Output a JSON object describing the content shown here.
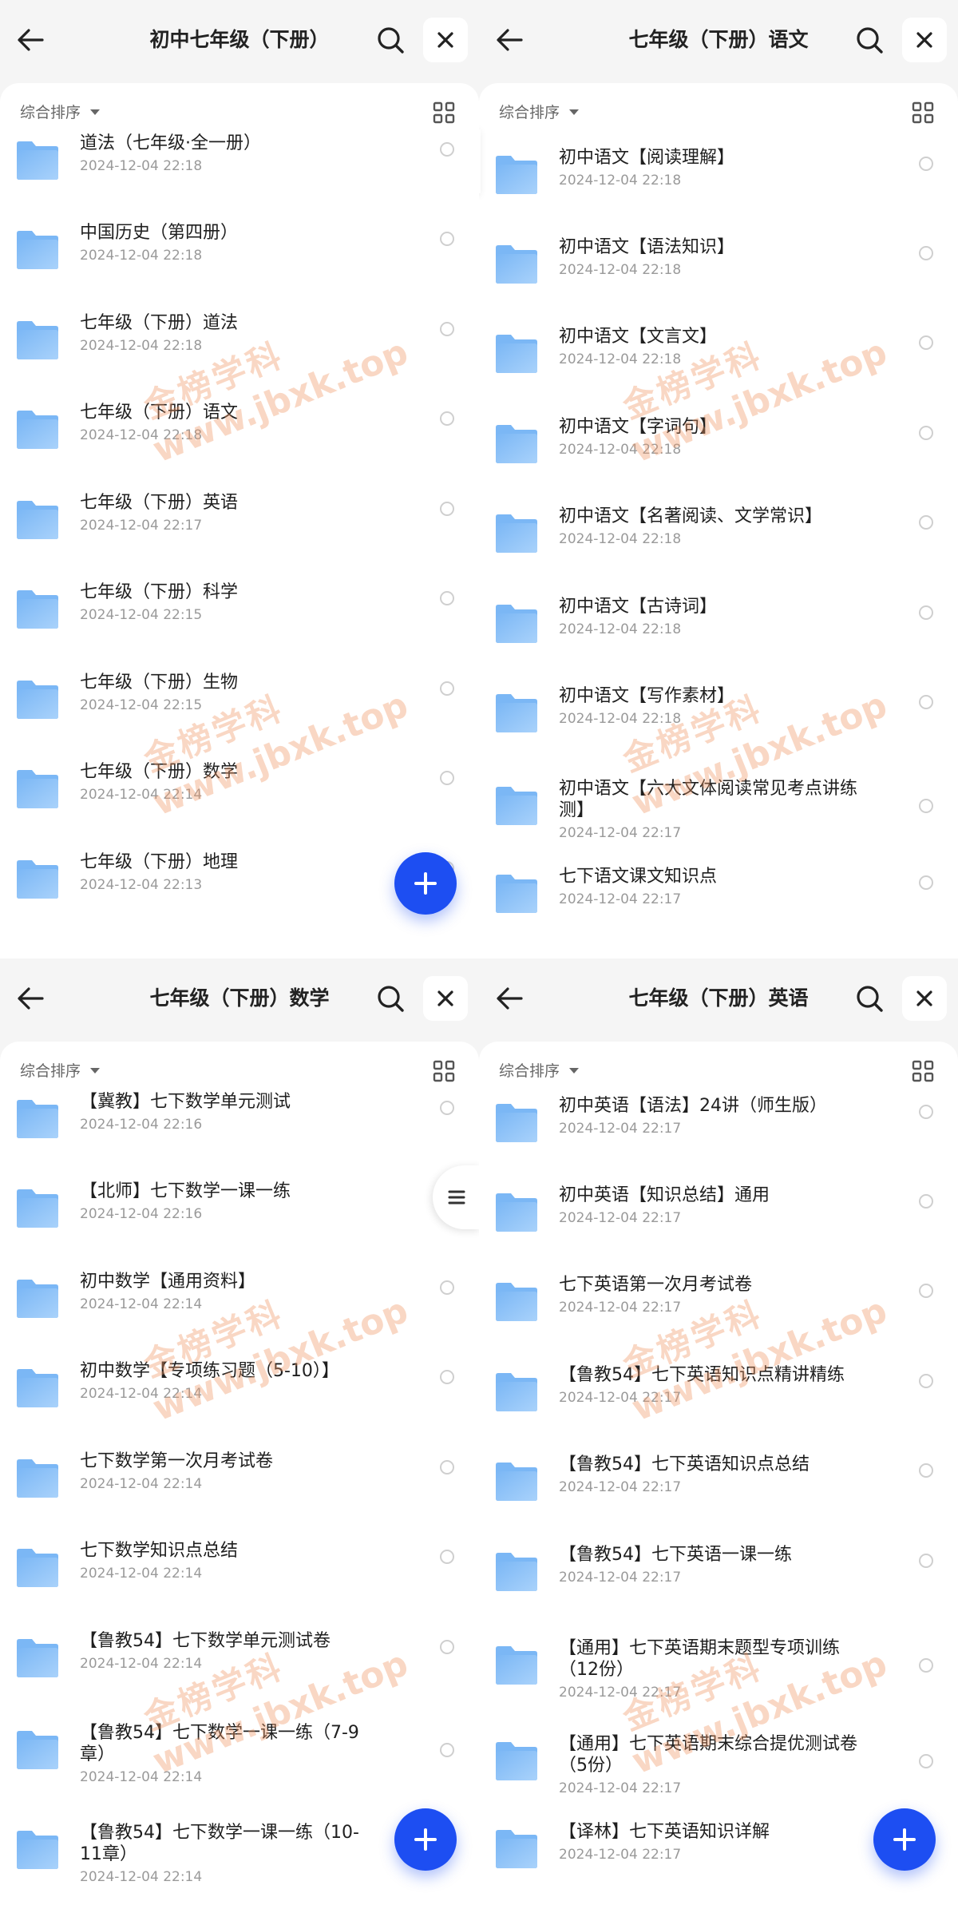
{
  "colors": {
    "accent": "#1d4ef2",
    "folder_top": "#7bb7f5",
    "folder_body": "#a9d2fb"
  },
  "icons": {
    "back": "arrow-left-icon",
    "search": "search-icon",
    "close": "close-icon",
    "grid": "grid-view-icon",
    "folder": "folder-icon",
    "add": "plus-icon",
    "menu": "menu-lines-icon"
  },
  "watermark": {
    "text_cn": "金榜学科",
    "text_url": "www.jbxk.top"
  },
  "panels": [
    {
      "title": "初中七年级（下册）",
      "sort_label": "综合排序",
      "items": [
        {
          "name": "道法（七年级·全一册）",
          "date": "2024-12-04 22:18"
        },
        {
          "name": "中国历史（第四册）",
          "date": "2024-12-04 22:18"
        },
        {
          "name": "七年级（下册）道法",
          "date": "2024-12-04 22:18"
        },
        {
          "name": "七年级（下册）语文",
          "date": "2024-12-04 22:18"
        },
        {
          "name": "七年级（下册）英语",
          "date": "2024-12-04 22:17"
        },
        {
          "name": "七年级（下册）科学",
          "date": "2024-12-04 22:15"
        },
        {
          "name": "七年级（下册）生物",
          "date": "2024-12-04 22:15"
        },
        {
          "name": "七年级（下册）数学",
          "date": "2024-12-04 22:14"
        },
        {
          "name": "七年级（下册）地理",
          "date": "2024-12-04 22:13"
        }
      ]
    },
    {
      "title": "七年级（下册）语文",
      "sort_label": "综合排序",
      "items": [
        {
          "name": "初中语文【阅读理解】",
          "date": "2024-12-04 22:18"
        },
        {
          "name": "初中语文【语法知识】",
          "date": "2024-12-04 22:18"
        },
        {
          "name": "初中语文【文言文】",
          "date": "2024-12-04 22:18"
        },
        {
          "name": "初中语文【字词句】",
          "date": "2024-12-04 22:18"
        },
        {
          "name": "初中语文【名著阅读、文学常识】",
          "date": "2024-12-04 22:18"
        },
        {
          "name": "初中语文【古诗词】",
          "date": "2024-12-04 22:18"
        },
        {
          "name": "初中语文【写作素材】",
          "date": "2024-12-04 22:18"
        },
        {
          "name": "初中语文【六大文体阅读常见考点讲练测】",
          "date": "2024-12-04 22:17"
        },
        {
          "name": "七下语文课文知识点",
          "date": "2024-12-04 22:17"
        }
      ]
    },
    {
      "title": "七年级（下册）数学",
      "sort_label": "综合排序",
      "items": [
        {
          "name": "【冀教】七下数学单元测试",
          "date": "2024-12-04 22:16"
        },
        {
          "name": "【北师】七下数学一课一练",
          "date": "2024-12-04 22:16"
        },
        {
          "name": "初中数学【通用资料】",
          "date": "2024-12-04 22:14"
        },
        {
          "name": "初中数学【专项练习题（5-10）】",
          "date": "2024-12-04 22:14"
        },
        {
          "name": "七下数学第一次月考试卷",
          "date": "2024-12-04 22:14"
        },
        {
          "name": "七下数学知识点总结",
          "date": "2024-12-04 22:14"
        },
        {
          "name": "【鲁教54】七下数学单元测试卷",
          "date": "2024-12-04 22:14"
        },
        {
          "name": "【鲁教54】七下数学一课一练（7-9章）",
          "date": "2024-12-04 22:14"
        },
        {
          "name": "【鲁教54】七下数学一课一练（10-11章）",
          "date": "2024-12-04 22:14"
        }
      ]
    },
    {
      "title": "七年级（下册）英语",
      "sort_label": "综合排序",
      "items": [
        {
          "name": "初中英语【语法】24讲（师生版）",
          "date": "2024-12-04 22:17"
        },
        {
          "name": "初中英语【知识总结】通用",
          "date": "2024-12-04 22:17"
        },
        {
          "name": "七下英语第一次月考试卷",
          "date": "2024-12-04 22:17"
        },
        {
          "name": "【鲁教54】七下英语知识点精讲精练",
          "date": "2024-12-04 22:17"
        },
        {
          "name": "【鲁教54】七下英语知识点总结",
          "date": "2024-12-04 22:17"
        },
        {
          "name": "【鲁教54】七下英语一课一练",
          "date": "2024-12-04 22:17"
        },
        {
          "name": "【通用】七下英语期末题型专项训练（12份）",
          "date": "2024-12-04 22:17"
        },
        {
          "name": "【通用】七下英语期末综合提优测试卷（5份）",
          "date": "2024-12-04 22:17"
        },
        {
          "name": "【译林】七下英语知识详解",
          "date": "2024-12-04 22:17"
        }
      ]
    }
  ]
}
